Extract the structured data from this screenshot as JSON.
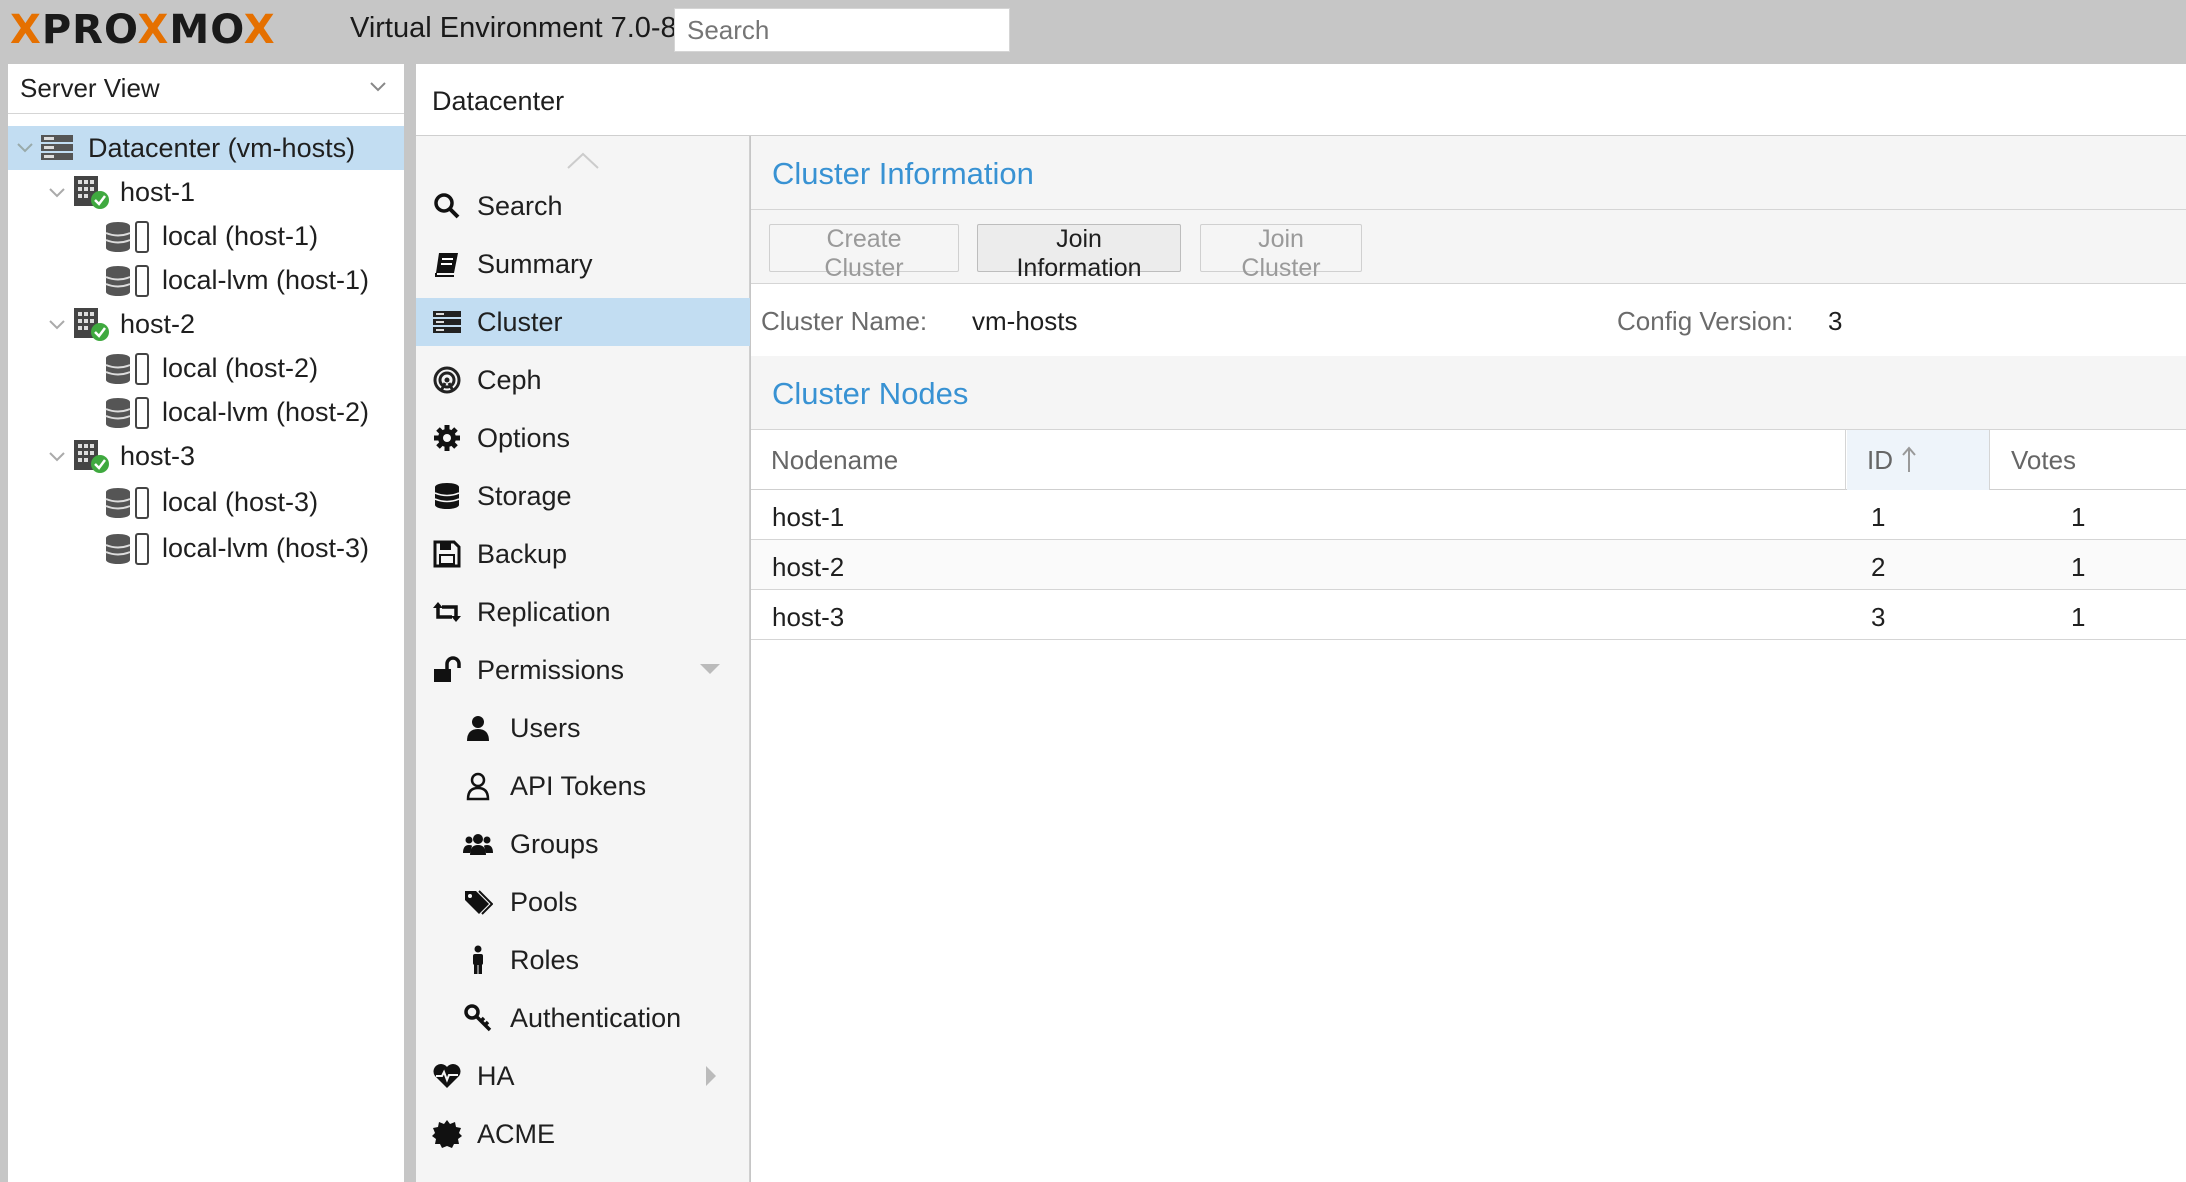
{
  "header": {
    "brand_left": "PRO",
    "brand_x": "X",
    "brand_mid": "MO",
    "brand_right": "X",
    "title": "Virtual Environment 7.0-8",
    "search_placeholder": "Search"
  },
  "tree": {
    "view_label": "Server View",
    "items": [
      {
        "label": "Datacenter (vm-hosts)"
      },
      {
        "label": "host-1"
      },
      {
        "label": "local (host-1)"
      },
      {
        "label": "local-lvm (host-1)"
      },
      {
        "label": "host-2"
      },
      {
        "label": "local (host-2)"
      },
      {
        "label": "local-lvm (host-2)"
      },
      {
        "label": "host-3"
      },
      {
        "label": "local (host-3)"
      },
      {
        "label": "local-lvm (host-3)"
      }
    ]
  },
  "breadcrumb": "Datacenter",
  "nav": {
    "items": [
      {
        "label": "Search"
      },
      {
        "label": "Summary"
      },
      {
        "label": "Cluster"
      },
      {
        "label": "Ceph"
      },
      {
        "label": "Options"
      },
      {
        "label": "Storage"
      },
      {
        "label": "Backup"
      },
      {
        "label": "Replication"
      },
      {
        "label": "Permissions"
      },
      {
        "label": "Users"
      },
      {
        "label": "API Tokens"
      },
      {
        "label": "Groups"
      },
      {
        "label": "Pools"
      },
      {
        "label": "Roles"
      },
      {
        "label": "Authentication"
      },
      {
        "label": "HA"
      },
      {
        "label": "ACME"
      }
    ]
  },
  "cluster": {
    "info_title": "Cluster Information",
    "buttons": {
      "create": "Create Cluster",
      "join_info": "Join Information",
      "join": "Join Cluster"
    },
    "name_label": "Cluster Name:",
    "name_value": "vm-hosts",
    "config_label": "Config Version:",
    "config_value": "3",
    "nodes_title": "Cluster Nodes",
    "columns": [
      "Nodename",
      "ID",
      "Votes"
    ],
    "rows": [
      {
        "nodename": "host-1",
        "id": "1",
        "votes": "1"
      },
      {
        "nodename": "host-2",
        "id": "2",
        "votes": "1"
      },
      {
        "nodename": "host-3",
        "id": "3",
        "votes": "1"
      }
    ]
  },
  "colors": {
    "accent": "#3892d3",
    "selected": "#c2ddf2",
    "brand_orange": "#e57000",
    "ok_green": "#3fa93f"
  }
}
